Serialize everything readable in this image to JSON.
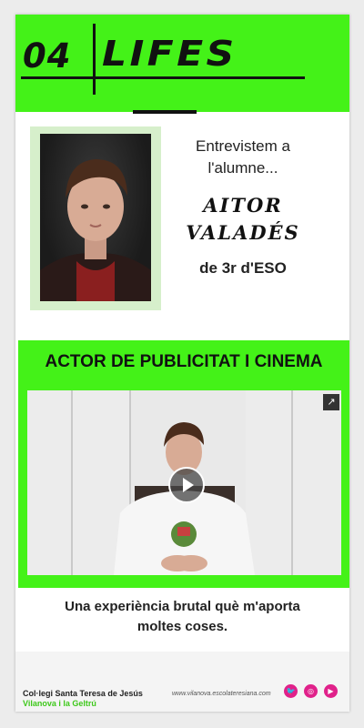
{
  "header": {
    "number": "04",
    "word": "LIFES"
  },
  "intro": {
    "line1": "Entrevistem a",
    "line2": "l'alumne...",
    "name_first": "AITOR",
    "name_last": "VALADÉS",
    "class": "de 3r d'ESO"
  },
  "section": {
    "title": "ACTOR DE PUBLICITAT I CINEMA",
    "external_icon": "external-link-icon",
    "play_icon": "play-icon"
  },
  "caption": {
    "line1": "Una experiència brutal què m'aporta",
    "line2": "moltes coses."
  },
  "footer": {
    "school": "Col·legi Santa Teresa de Jesús",
    "town": "Vilanova i la Geltrú",
    "website": "www.vilanova.escolateresiana.com",
    "social": [
      "twitter-icon",
      "instagram-icon",
      "youtube-icon"
    ]
  },
  "colors": {
    "accent_green": "#44f218",
    "social_pink": "#e0218a"
  }
}
